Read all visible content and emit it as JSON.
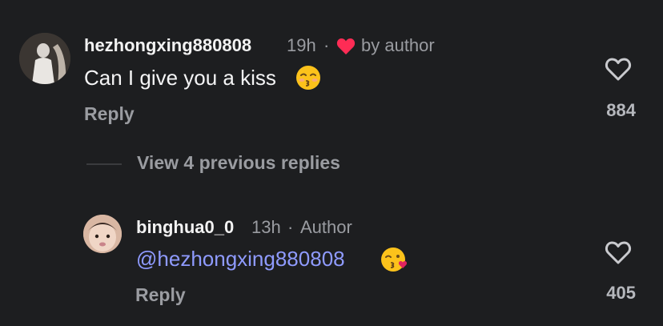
{
  "comments": [
    {
      "username": "hezhongxing880808",
      "time": "19h",
      "separator": "·",
      "liked_by_author": "by author",
      "text": "Can I give you a kiss",
      "emoji": "😚",
      "reply_label": "Reply",
      "likes": "884"
    },
    {
      "username": "binghua0_0",
      "time": "13h",
      "separator": "·",
      "author_badge": "Author",
      "mention": "@hezhongxing880808",
      "emoji": "😘",
      "reply_label": "Reply",
      "likes": "405"
    }
  ],
  "view_previous_replies": "View 4 previous replies",
  "colors": {
    "background": "#1d1e20",
    "mention": "#8f9bff",
    "heart": "#fe2c55",
    "muted": "#9a9ca1"
  },
  "icons": [
    "heart-filled-icon",
    "heart-outline-icon"
  ]
}
